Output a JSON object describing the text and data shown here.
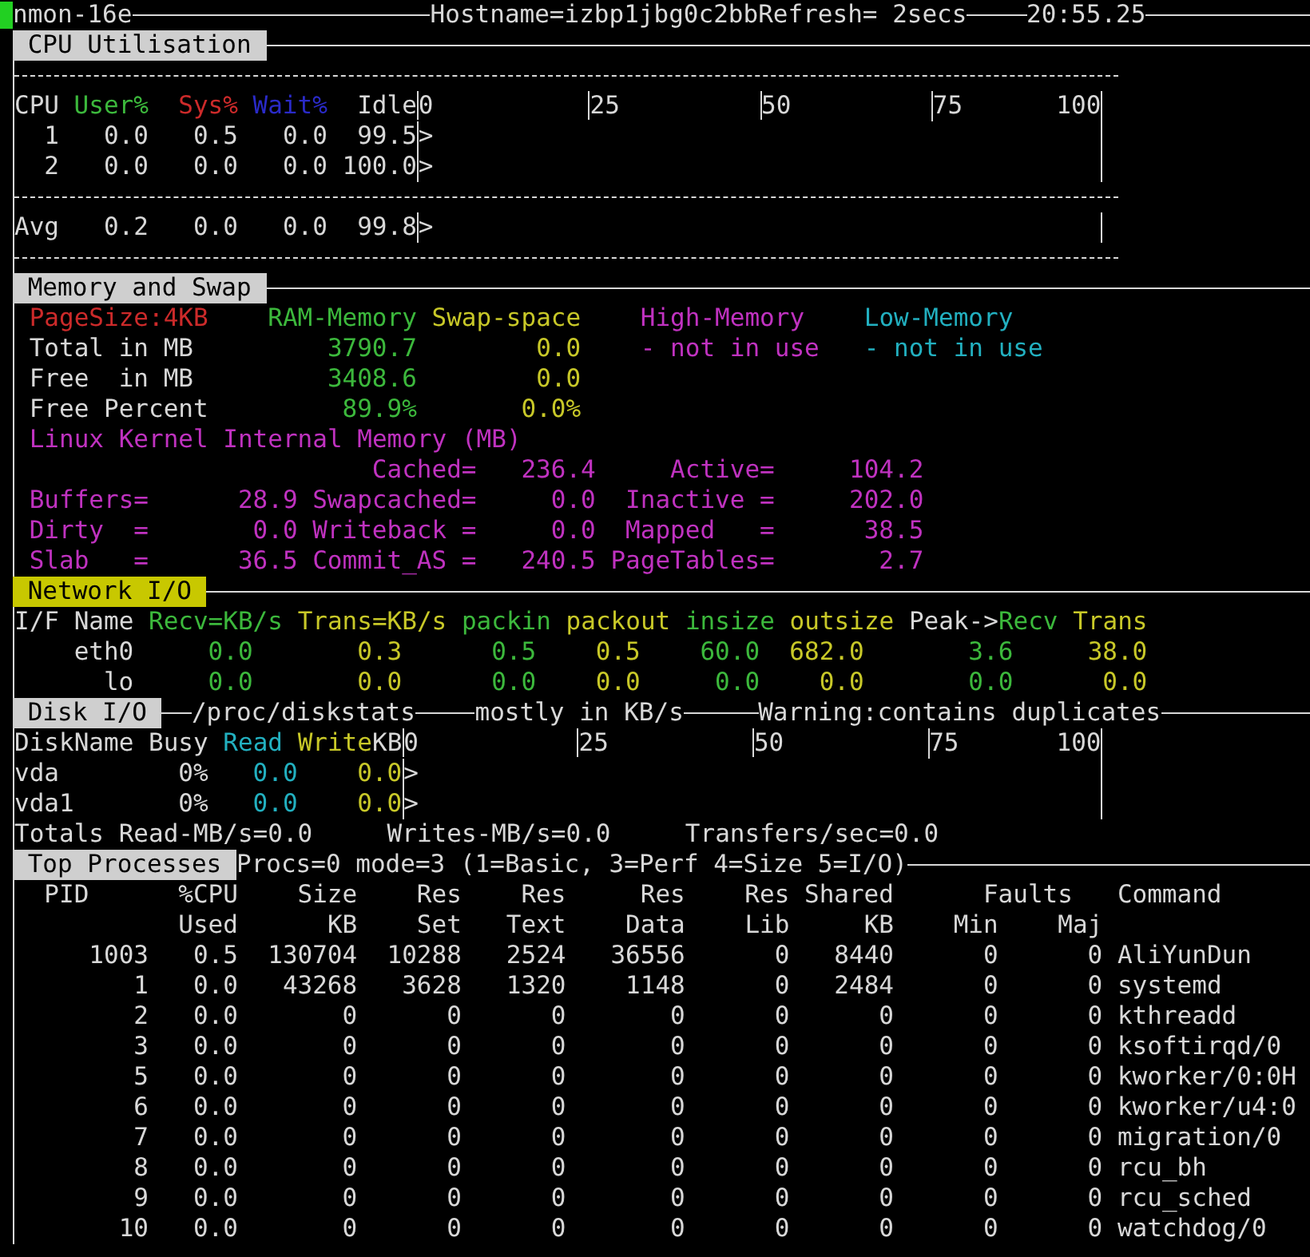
{
  "header": {
    "program": "nmon-16e",
    "host": "Hostname=izbp1jbg0c2bbRefresh= 2secs",
    "time": "20:55.25"
  },
  "cpu": {
    "title": "CPU Utilisation",
    "color": "#cfcfcf",
    "columns": [
      {
        "label": "CPU",
        "color": "#d8d8d8"
      },
      {
        "label": "User%",
        "color": "#3cb83c"
      },
      {
        "label": "Sys%",
        "color": "#cc2a2a"
      },
      {
        "label": "Wait%",
        "color": "#2a2ac8"
      },
      {
        "label": "Idle",
        "color": "#d8d8d8"
      }
    ],
    "scale": [
      "0",
      "25",
      "50",
      "75",
      "100"
    ],
    "rows": [
      {
        "cells": [
          "1",
          "0.0",
          "0.5",
          "0.0",
          "99.5"
        ],
        "bar": ">"
      },
      {
        "cells": [
          "2",
          "0.0",
          "0.0",
          "0.0",
          "100.0"
        ],
        "bar": ">"
      }
    ],
    "average": {
      "cells": [
        "Avg",
        "0.2",
        "0.0",
        "0.0",
        "99.8"
      ],
      "bar": ">"
    }
  },
  "memory": {
    "title": "Memory and Swap",
    "color": "#cfcfcf",
    "columns": [
      {
        "label": "PageSize:4KB",
        "color": "#cc2a2a"
      },
      {
        "label": "RAM-Memory",
        "color": "#3cb83c"
      },
      {
        "label": "Swap-space",
        "color": "#c8c828"
      },
      {
        "label": "High-Memory",
        "color": "#c032c0"
      },
      {
        "label": "Low-Memory",
        "color": "#22b0c0"
      }
    ],
    "rows": [
      {
        "label": "Total in MB",
        "values": [
          "3790.7",
          "0.0",
          "- not in use",
          "- not in use"
        ]
      },
      {
        "label": "Free  in MB",
        "values": [
          "3408.6",
          "0.0"
        ]
      },
      {
        "label": "Free Percent",
        "values": [
          "89.9%",
          "0.0%"
        ]
      }
    ],
    "kernel_title": "Linux Kernel Internal Memory (MB)",
    "kernel_columns": [
      [
        {
          "label": "Buffers=",
          "value": "28.9"
        },
        {
          "label": "Dirty  =",
          "value": "0.0"
        },
        {
          "label": "Slab   =",
          "value": "36.5"
        }
      ],
      [
        {
          "label": "Cached=",
          "value": "236.4"
        },
        {
          "label": "Swapcached=",
          "value": "0.0"
        },
        {
          "label": "Writeback =",
          "value": "0.0"
        },
        {
          "label": "Commit_AS =",
          "value": "240.5"
        }
      ],
      [
        {
          "label": "Active=",
          "value": "104.2"
        },
        {
          "label": "Inactive =",
          "value": "202.0"
        },
        {
          "label": "Mapped   =",
          "value": "38.5"
        },
        {
          "label": "PageTables=",
          "value": "2.7"
        }
      ]
    ]
  },
  "network": {
    "title": "Network I/O",
    "color": "#c8c800",
    "headers": [
      {
        "label": "I/F Name",
        "attached": false
      },
      {
        "label": "Recv=KB/s",
        "color": "#3cb83c",
        "attached": false
      },
      {
        "label": "Trans=KB/s",
        "color": "#c8c828",
        "attached": false
      },
      {
        "label": "packin",
        "color": "#3cb83c",
        "attached": false
      },
      {
        "label": "packout",
        "color": "#c8c828",
        "attached": false
      },
      {
        "label": "insize",
        "color": "#3cb83c",
        "attached": false
      },
      {
        "label": "outsize",
        "color": "#c8c828",
        "attached": false
      },
      {
        "label": "Peak->",
        "attached": false
      },
      {
        "label": "Recv",
        "color": "#3cb83c",
        "attached": true
      },
      {
        "label": "Trans",
        "color": "#c8c828",
        "attached": false
      }
    ],
    "rows": [
      {
        "name": "eth0",
        "values": [
          "0.0",
          "0.3",
          "0.5",
          "0.5",
          "60.0",
          "682.0",
          "3.6",
          "38.0"
        ]
      },
      {
        "name": "lo",
        "values": [
          "0.0",
          "0.0",
          "0.0",
          "0.0",
          "0.0",
          "0.0",
          "0.0",
          "0.0"
        ]
      }
    ]
  },
  "disk": {
    "title": "Disk I/O",
    "color": "#cfcfcf",
    "notes": [
      "/proc/diskstats",
      "mostly in KB/s",
      "Warning:contains duplicates"
    ],
    "headers": [
      {
        "label": "DiskName Busy",
        "color": "#d8d8d8",
        "attached": false
      },
      {
        "label": "Read",
        "color": "#22b0c0",
        "attached": false
      },
      {
        "label": "Write",
        "color": "#c8c828",
        "attached": false
      },
      {
        "label": "KB",
        "color": "#d8d8d8",
        "attached": true
      }
    ],
    "scale": [
      "0",
      "25",
      "50",
      "75",
      "100"
    ],
    "rows": [
      {
        "name": "vda",
        "busy": "0%",
        "read": "0.0",
        "write": "0.0",
        "bar": ">"
      },
      {
        "name": "vda1",
        "busy": "0%",
        "read": "0.0",
        "write": "0.0",
        "bar": ">"
      }
    ],
    "totals": [
      "Totals Read-MB/s=0.0",
      "Writes-MB/s=0.0",
      "Transfers/sec=0.0"
    ]
  },
  "processes": {
    "title": "Top Processes",
    "color": "#cfcfcf",
    "summary": "Procs=0 mode=3 (1=Basic, 3=Perf 4=Size 5=I/O)",
    "columns": [
      {
        "top": "PID"
      },
      {
        "top": "%CPU",
        "bottom": "Used"
      },
      {
        "top": "Size",
        "bottom": "KB"
      },
      {
        "top": "Res",
        "bottom": "Set"
      },
      {
        "top": "Res",
        "bottom": "Text"
      },
      {
        "top": "Res",
        "bottom": "Data"
      },
      {
        "top": "Res",
        "bottom": "Lib"
      },
      {
        "top": "Shared",
        "bottom": "KB"
      },
      {
        "bottom": "Min"
      },
      {
        "bottom": "Maj"
      },
      {
        "top": "Command"
      }
    ],
    "faults_label": "Faults",
    "rows": [
      {
        "cells": [
          "1003",
          "0.5",
          "130704",
          "10288",
          "2524",
          "36556",
          "0",
          "8440",
          "0",
          "0",
          "AliYunDun"
        ]
      },
      {
        "cells": [
          "1",
          "0.0",
          "43268",
          "3628",
          "1320",
          "1148",
          "0",
          "2484",
          "0",
          "0",
          "systemd"
        ]
      },
      {
        "cells": [
          "2",
          "0.0",
          "0",
          "0",
          "0",
          "0",
          "0",
          "0",
          "0",
          "0",
          "kthreadd"
        ]
      },
      {
        "cells": [
          "3",
          "0.0",
          "0",
          "0",
          "0",
          "0",
          "0",
          "0",
          "0",
          "0",
          "ksoftirqd/0"
        ]
      },
      {
        "cells": [
          "5",
          "0.0",
          "0",
          "0",
          "0",
          "0",
          "0",
          "0",
          "0",
          "0",
          "kworker/0:0H"
        ]
      },
      {
        "cells": [
          "6",
          "0.0",
          "0",
          "0",
          "0",
          "0",
          "0",
          "0",
          "0",
          "0",
          "kworker/u4:0"
        ]
      },
      {
        "cells": [
          "7",
          "0.0",
          "0",
          "0",
          "0",
          "0",
          "0",
          "0",
          "0",
          "0",
          "migration/0"
        ]
      },
      {
        "cells": [
          "8",
          "0.0",
          "0",
          "0",
          "0",
          "0",
          "0",
          "0",
          "0",
          "0",
          "rcu_bh"
        ]
      },
      {
        "cells": [
          "9",
          "0.0",
          "0",
          "0",
          "0",
          "0",
          "0",
          "0",
          "0",
          "0",
          "rcu_sched"
        ]
      },
      {
        "cells": [
          "10",
          "0.0",
          "0",
          "0",
          "0",
          "0",
          "0",
          "0",
          "0",
          "0",
          "watchdog/0"
        ]
      }
    ]
  }
}
